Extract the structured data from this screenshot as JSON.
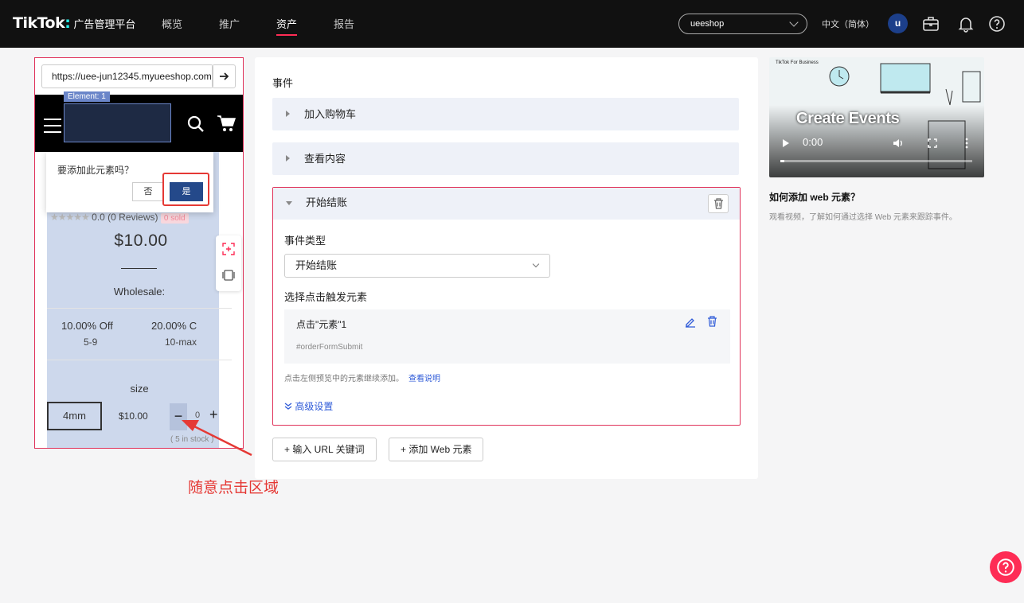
{
  "topnav": {
    "logo": "TikTok",
    "logo_sub": "广告管理平台",
    "items": [
      {
        "label": "概览"
      },
      {
        "label": "推广"
      },
      {
        "label": "资产"
      },
      {
        "label": "报告"
      }
    ],
    "active_item": "资产",
    "account": "ueeshop",
    "language": "中文（简体）",
    "avatar": "u",
    "icons": [
      "briefcase-icon",
      "bell-icon",
      "help-icon"
    ]
  },
  "preview": {
    "url": "https://uee-jun12345.myueeshop.com",
    "element_tag": "Element: 1",
    "confirm_question": "要添加此元素吗？",
    "no_label": "否",
    "yes_label": "是",
    "rating": "0.0 (0 Reviews)",
    "sold": "0 sold",
    "price": "$10.00",
    "wholesale_label": "Wholesale:",
    "tiers": [
      {
        "discount": "10.00% Off",
        "range": "5-9"
      },
      {
        "discount": "20.00% C",
        "range": "10-max"
      }
    ],
    "size_label": "size",
    "variant": {
      "name": "4mm",
      "price": "$10.00",
      "qty": "0",
      "stock": "( 5 in stock )"
    }
  },
  "main": {
    "section_title": "事件",
    "collapsed_events": [
      "加入购物车",
      "查看内容"
    ],
    "open_event": {
      "title": "开始结账",
      "type_label": "事件类型",
      "type_value": "开始结账",
      "trigger_label": "选择点击触发元素",
      "element_title": "点击\"元素\"1",
      "element_selector": "#orderFormSubmit",
      "hint": "点击左侧预览中的元素继续添加。",
      "hint_link": "查看说明",
      "advanced": "高级设置"
    },
    "add_url_keyword": "输入 URL 关键词",
    "add_web_element": "添加 Web 元素"
  },
  "right": {
    "video_title": "Create Events",
    "video_time": "0:00",
    "video_logo": "TikTok For Business",
    "howto_title": "如何添加 web 元素？",
    "howto_desc": "观看视频，了解如何通过选择 Web 元素来跟踪事件。"
  },
  "annotation": {
    "text": "随意点击区域"
  },
  "colors": {
    "accent": "#fe2c55",
    "primary": "#24498a",
    "link": "#2f5bd8",
    "annotation": "#e53935"
  }
}
